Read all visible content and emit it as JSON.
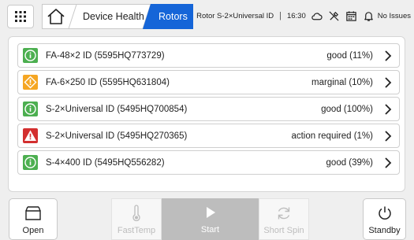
{
  "header": {
    "breadcrumb": {
      "home_icon": "home-icon",
      "device_health": "Device Health",
      "rotors": "Rotors"
    },
    "status": {
      "rotor": "Rotor S-2×Universal ID",
      "time": "16:30",
      "issues": "No Issues"
    },
    "accent_color": "#1565d8"
  },
  "rotors": [
    {
      "name": "FA-48×2 ID (5595HQ773729)",
      "health": "good (11%)",
      "status": "good",
      "icon": "info-icon"
    },
    {
      "name": "FA-6×250 ID (5595HQ631804)",
      "health": "marginal (10%)",
      "status": "marginal",
      "icon": "warning-diamond-icon"
    },
    {
      "name": "S-2×Universal ID (5495HQ700854)",
      "health": "good (100%)",
      "status": "good",
      "icon": "info-icon"
    },
    {
      "name": "S-2×Universal ID (5495HQ270365)",
      "health": "action required (1%)",
      "status": "action",
      "icon": "alert-triangle-icon"
    },
    {
      "name": "S-4×400 ID (5495HQ556282)",
      "health": "good (39%)",
      "status": "good",
      "icon": "info-icon"
    }
  ],
  "status_colors": {
    "good": "#4caf50",
    "marginal": "#f5a623",
    "action": "#d32f2f"
  },
  "toolbar": {
    "open": "Open",
    "fasttemp": "FastTemp",
    "start": "Start",
    "shortspin": "Short Spin",
    "standby": "Standby"
  }
}
